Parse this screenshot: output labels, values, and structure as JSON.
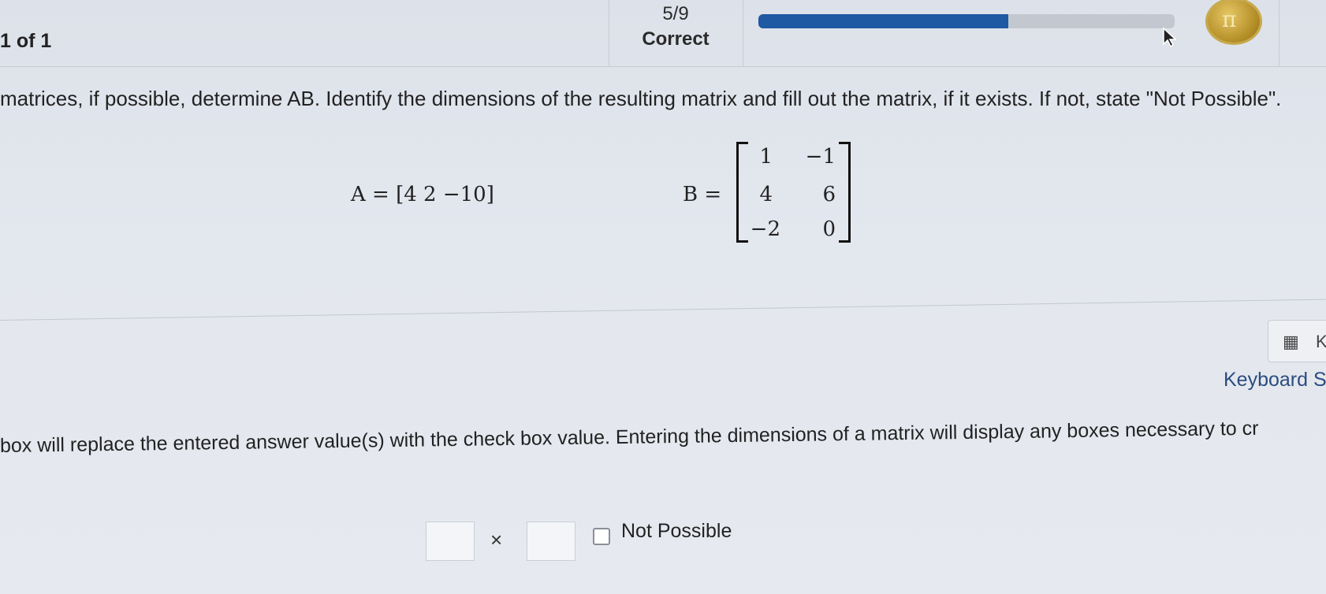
{
  "header": {
    "question_counter": "1 of 1",
    "score_fraction": "5/9",
    "score_label": "Correct",
    "progress_fraction": 0.6
  },
  "question": {
    "prompt": "matrices, if possible, determine AB. Identify the dimensions of the resulting matrix and fill out the matrix, if it exists. If not, state \"Not Possible\".",
    "matrix_A_label": "A =",
    "matrix_A_entries": "[4  2  −10]",
    "matrix_B_label": "B =",
    "matrix_B": {
      "r1c1": "1",
      "r1c2": "−1",
      "r2c1": "4",
      "r2c2": "6",
      "r3c1": "−2",
      "r3c2": "0"
    }
  },
  "keyboard": {
    "label": "Keyboard S",
    "button_letter": "K"
  },
  "answer": {
    "instructions": "box will replace the entered answer value(s) with the check box value. Entering the dimensions of a matrix will display any boxes necessary to cr",
    "rows_value": "",
    "cols_value": "",
    "times_symbol": "×",
    "not_possible_label": "Not Possible"
  },
  "icons": {
    "calculator": "calculator-icon",
    "cursor": "mouse-cursor-icon",
    "coin": "pi-coin-icon"
  }
}
